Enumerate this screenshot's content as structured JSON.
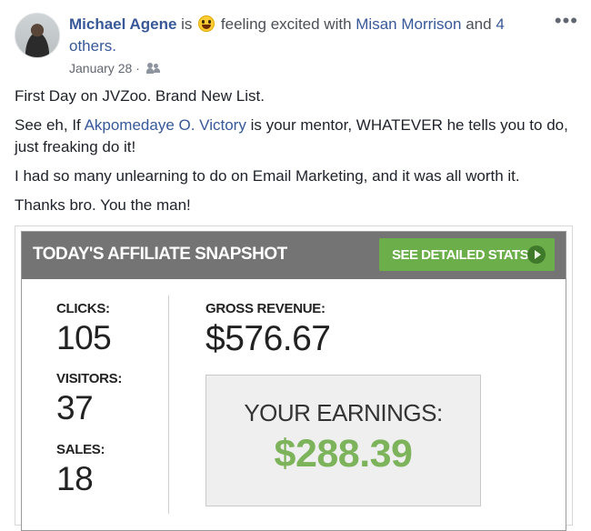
{
  "post": {
    "author": "Michael Agene",
    "is_text": "is",
    "feeling_text": "feeling excited with",
    "tagged_person": "Misan Morrison",
    "and_text": "and",
    "others_link": "4 others.",
    "date": "January 28",
    "separator": "·",
    "paragraphs": {
      "p1": "First Day on JVZoo. Brand New List.",
      "p2_before": "See eh, If ",
      "p2_mention": "Akpomedaye O. Victory",
      "p2_after": " is your mentor, WHATEVER he tells you to do, just freaking do it!",
      "p3": "I had so many unlearning to do on Email Marketing, and it was all worth it.",
      "p4": "Thanks bro. You the man!"
    }
  },
  "snapshot": {
    "title": "Today's Affiliate Snapshot",
    "button_label": "SEE DETAILED STATS",
    "clicks_label": "CLICKS:",
    "clicks_value": "105",
    "visitors_label": "VISITORS:",
    "visitors_value": "37",
    "sales_label": "SALES:",
    "sales_value": "18",
    "gross_label": "GROSS REVENUE:",
    "gross_value": "$576.67",
    "earnings_label": "YOUR EARNINGS:",
    "earnings_value": "$288.39"
  },
  "colors": {
    "link": "#385898",
    "header_bar": "#747474",
    "button_green": "#6cae4a",
    "earnings_green": "#7cb35b"
  },
  "icons": [
    "avatar",
    "feeling-excited-emoji-icon",
    "friends-audience-icon",
    "more-options-icon",
    "play-icon"
  ]
}
